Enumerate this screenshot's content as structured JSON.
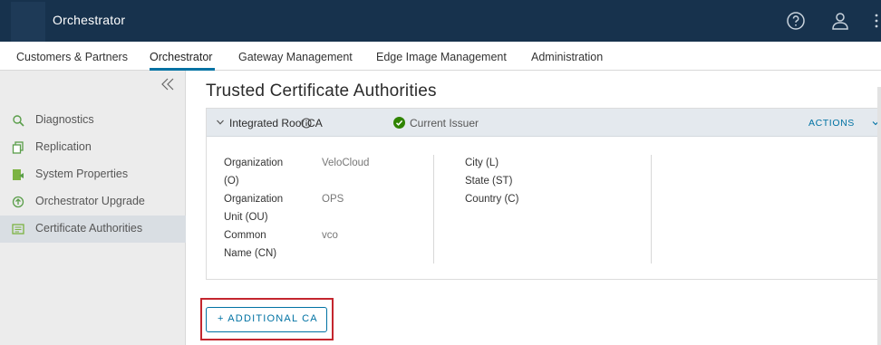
{
  "header": {
    "app_title": "Orchestrator",
    "icons": [
      "help-icon",
      "user-icon",
      "more-icon"
    ]
  },
  "topnav": {
    "items": [
      {
        "label": "Customers & Partners"
      },
      {
        "label": "Orchestrator",
        "active": true
      },
      {
        "label": "Gateway Management"
      },
      {
        "label": "Edge Image Management"
      },
      {
        "label": "Administration"
      }
    ]
  },
  "sidebar": {
    "items": [
      {
        "label": "Diagnostics",
        "icon": "diagnostics-icon"
      },
      {
        "label": "Replication",
        "icon": "replication-icon"
      },
      {
        "label": "System Properties",
        "icon": "system-properties-icon"
      },
      {
        "label": "Orchestrator Upgrade",
        "icon": "upgrade-icon"
      },
      {
        "label": "Certificate Authorities",
        "icon": "certificate-icon",
        "selected": true
      }
    ]
  },
  "main": {
    "page_title": "Trusted Certificate Authorities",
    "ca_panel": {
      "name": "Integrated Root CA",
      "status": "Current Issuer",
      "actions_label": "ACTIONS",
      "fields_left": [
        {
          "label": "Organization (O)",
          "value": "VeloCloud"
        },
        {
          "label": "Organization Unit (OU)",
          "value": "OPS"
        },
        {
          "label": "Common Name (CN)",
          "value": "vco"
        }
      ],
      "fields_right": [
        {
          "label": "City (L)"
        },
        {
          "label": "State (ST)"
        },
        {
          "label": "Country (C)"
        }
      ]
    },
    "add_button_label": "+ ADDITIONAL CA"
  },
  "colors": {
    "header_bg": "#17324d",
    "accent": "#0072a3",
    "success": "#2f8400",
    "highlight_border": "#c4262e"
  }
}
